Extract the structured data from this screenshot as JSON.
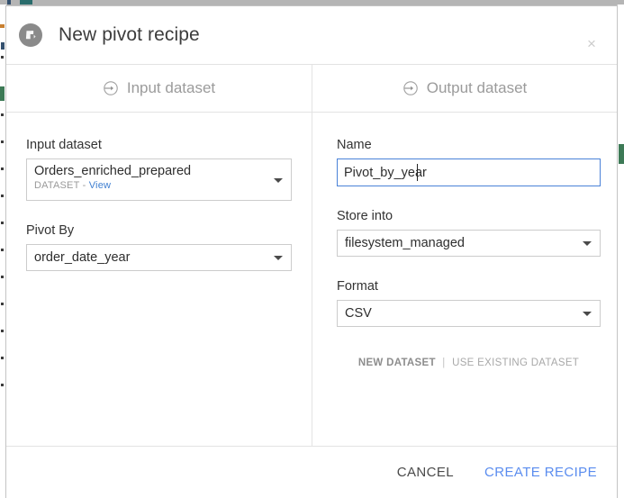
{
  "window": {
    "title": "New pivot recipe",
    "icon": "pivot-recipe-icon",
    "close_label": "×"
  },
  "tabs": [
    {
      "label": "Input dataset",
      "icon": "arrow-into-circle-icon"
    },
    {
      "label": "Output dataset",
      "icon": "arrow-into-circle-icon"
    }
  ],
  "input_panel": {
    "dataset": {
      "label": "Input dataset",
      "value": "Orders_enriched_prepared",
      "type_label": "DATASET",
      "separator": "-",
      "view_link": "View"
    },
    "pivot_by": {
      "label": "Pivot By",
      "value": "order_date_year"
    }
  },
  "output_panel": {
    "name": {
      "label": "Name",
      "value": "Pivot_by_year",
      "placeholder": ""
    },
    "store_into": {
      "label": "Store into",
      "value": "filesystem_managed"
    },
    "format": {
      "label": "Format",
      "value": "CSV"
    },
    "dataset_mode": {
      "active": "NEW DATASET",
      "separator": "|",
      "inactive": "USE EXISTING DATASET"
    }
  },
  "footer": {
    "cancel_label": "CANCEL",
    "create_label": "CREATE RECIPE"
  },
  "colors": {
    "accent_blue": "#5b8def",
    "focus_border": "#4a82d8",
    "link_blue": "#3f7fd1",
    "overlay_gray": "#b5b5b5",
    "background_green": "#3d7a56"
  }
}
